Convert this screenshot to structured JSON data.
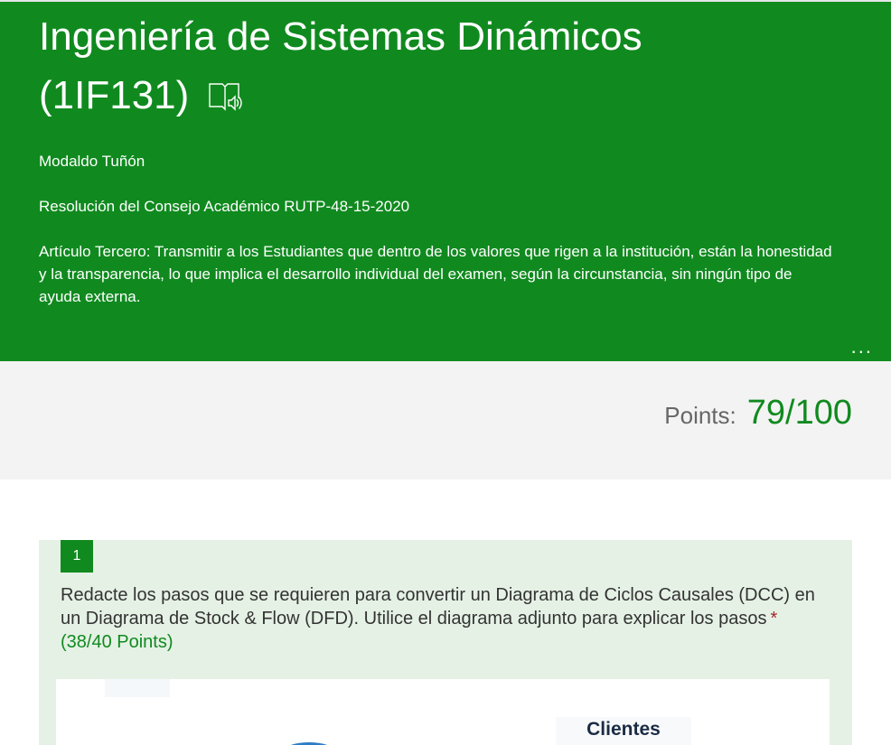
{
  "header": {
    "title": "Ingeniería de Sistemas Dinámicos (1IF131)",
    "author": "Modaldo Tuñón",
    "resolution": "Resolución del Consejo Académico RUTP-48-15-2020",
    "article": "Artículo Tercero: Transmitir a los Estudiantes que dentro de los valores que rigen a la institución, están la honestidad y la transparencia, lo que implica el desarrollo individual del examen, según la circunstancia, sin ningún tipo de ayuda externa.",
    "more_label": "...",
    "immersive_icon": "immersive-reader-icon"
  },
  "points": {
    "label": "Points:",
    "value": "79/100"
  },
  "question": {
    "number": "1",
    "text": "Redacte los pasos que se requieren para convertir un Diagrama de Ciclos Causales (DCC) en un Diagrama de Stock & Flow (DFD). Utilice el diagrama adjunto para explicar los pasos",
    "required_mark": "*",
    "points": "(38/40 Points)",
    "attachment_label": "Clientes"
  },
  "colors": {
    "brand": "#108a1f",
    "card_bg": "#e5f1e5",
    "band_bg": "#f3f3f3",
    "required": "#a4262c"
  }
}
